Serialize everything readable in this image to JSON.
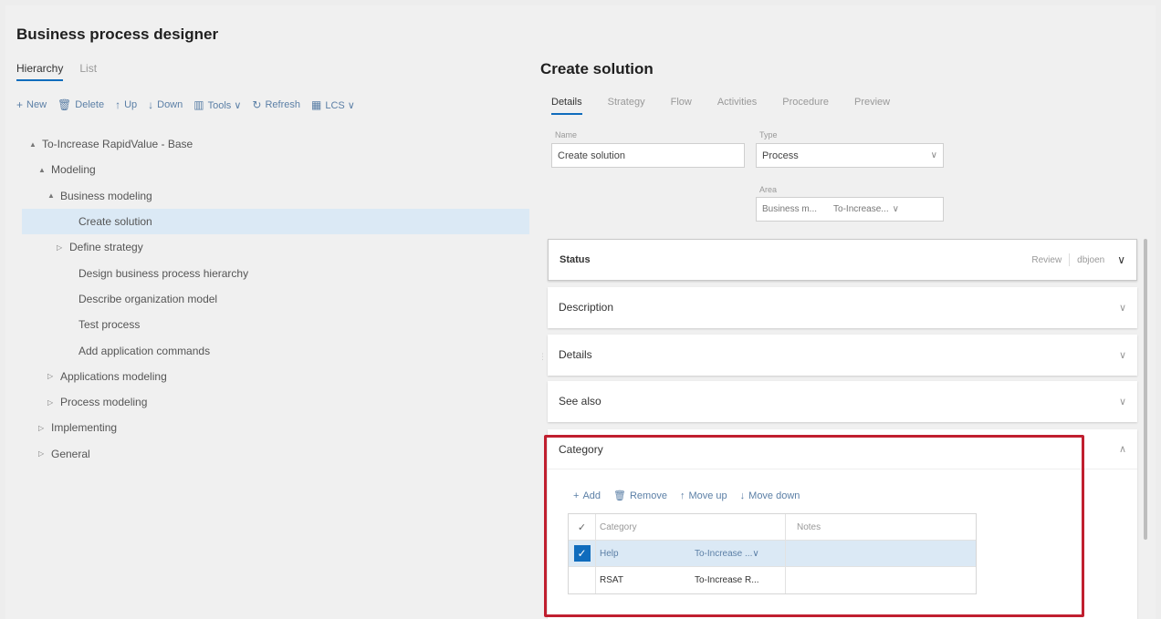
{
  "app": {
    "title": "Business process designer"
  },
  "left": {
    "tabs": [
      {
        "label": "Hierarchy",
        "active": true
      },
      {
        "label": "List",
        "active": false
      }
    ],
    "toolbar": [
      {
        "icon": "+",
        "label": "New"
      },
      {
        "icon": "🗑",
        "label": "Delete"
      },
      {
        "icon": "↑",
        "label": "Up"
      },
      {
        "icon": "↓",
        "label": "Down"
      },
      {
        "icon": "▥",
        "label": "Tools ∨"
      },
      {
        "icon": "↻",
        "label": "Refresh"
      },
      {
        "icon": "▦",
        "label": "LCS ∨"
      }
    ],
    "tree": [
      {
        "label": "To-Increase RapidValue - Base",
        "level": 0,
        "caret": "▲",
        "selected": false
      },
      {
        "label": "Modeling",
        "level": 1,
        "caret": "▲",
        "selected": false
      },
      {
        "label": "Business modeling",
        "level": 2,
        "caret": "▲",
        "selected": false
      },
      {
        "label": "Create solution",
        "level": 3,
        "caret": "",
        "selected": true
      },
      {
        "label": "Define strategy",
        "level": 3,
        "caret": "▷",
        "selected": false
      },
      {
        "label": "Design business process hierarchy",
        "level": 3,
        "caret": "",
        "selected": false
      },
      {
        "label": "Describe organization model",
        "level": 3,
        "caret": "",
        "selected": false
      },
      {
        "label": "Test process",
        "level": 3,
        "caret": "",
        "selected": false
      },
      {
        "label": "Add application commands",
        "level": 3,
        "caret": "",
        "selected": false
      },
      {
        "label": "Applications modeling",
        "level": 2,
        "caret": "▷",
        "selected": false
      },
      {
        "label": "Process modeling",
        "level": 2,
        "caret": "▷",
        "selected": false
      },
      {
        "label": "Implementing",
        "level": 1,
        "caret": "▷",
        "selected": false
      },
      {
        "label": "General",
        "level": 1,
        "caret": "▷",
        "selected": false
      }
    ]
  },
  "right": {
    "title": "Create solution",
    "tabs": [
      {
        "label": "Details",
        "active": true
      },
      {
        "label": "Strategy",
        "active": false
      },
      {
        "label": "Flow",
        "active": false
      },
      {
        "label": "Activities",
        "active": false
      },
      {
        "label": "Procedure",
        "active": false
      },
      {
        "label": "Preview",
        "active": false
      }
    ],
    "fields": {
      "name_label": "Name",
      "name_value": "Create solution",
      "type_label": "Type",
      "type_value": "Process",
      "area_label": "Area",
      "area_value_1": "Business m...",
      "area_value_2": "To-Increase..."
    },
    "sections": {
      "status": {
        "label": "Status",
        "review": "Review",
        "user": "dbjoen"
      },
      "description": {
        "label": "Description"
      },
      "details": {
        "label": "Details"
      },
      "see_also": {
        "label": "See also"
      },
      "category": {
        "label": "Category"
      }
    },
    "category_toolbar": [
      {
        "icon": "+",
        "label": "Add"
      },
      {
        "icon": "🗑",
        "label": "Remove"
      },
      {
        "icon": "↑",
        "label": "Move up"
      },
      {
        "icon": "↓",
        "label": "Move down"
      }
    ],
    "category_grid": {
      "headers": {
        "category": "Category",
        "notes": "Notes"
      },
      "rows": [
        {
          "category": "Help",
          "subcategory": "To-Increase ...∨",
          "notes": "",
          "selected": true
        },
        {
          "category": "RSAT",
          "subcategory": "To-Increase R...",
          "notes": "",
          "selected": false
        }
      ]
    }
  }
}
